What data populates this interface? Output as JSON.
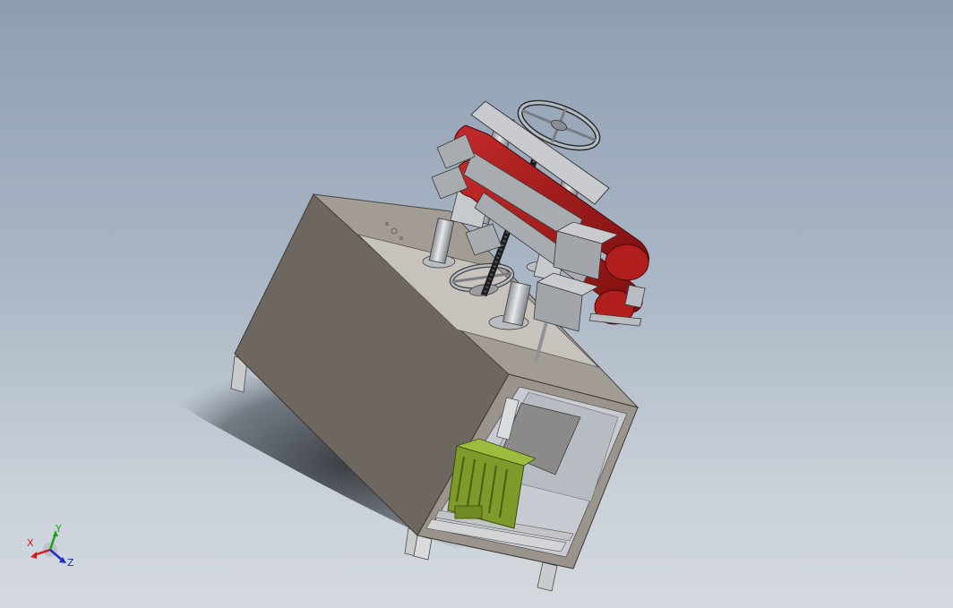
{
  "viewport": {
    "background_top": "#8e9eb2",
    "background_bottom": "#d4d9df"
  },
  "model": {
    "cabinet_color": "#7a716a",
    "cabinet_top_color": "#a39c94",
    "belt_color": "#b01e1e",
    "motor_color": "#7e9a2a",
    "steel_color": "#b9bcc0",
    "icon": "machine-model-icon"
  },
  "triad": {
    "x_label": "X",
    "y_label": "Y",
    "z_label": "Z",
    "x_color": "#d01e1e",
    "y_color": "#20a020",
    "z_color": "#1a2fc8"
  }
}
